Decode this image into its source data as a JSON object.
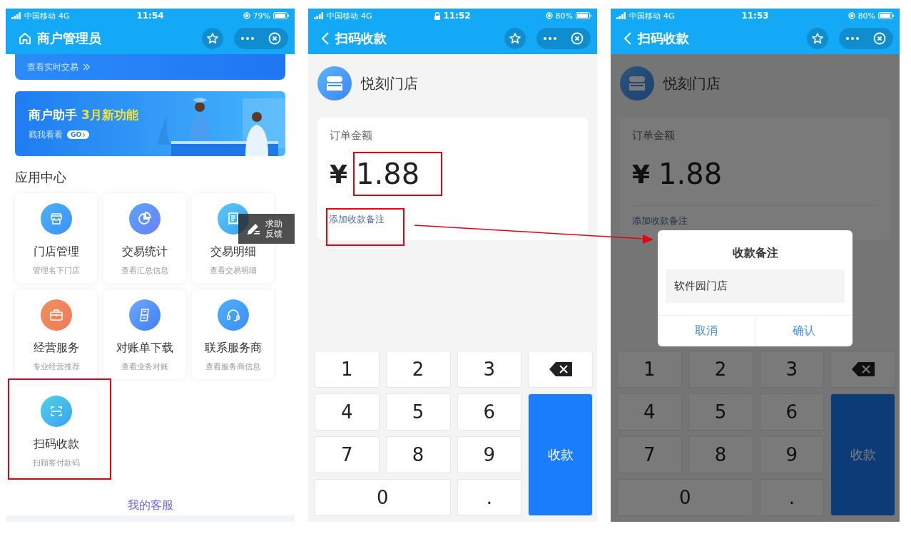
{
  "phones": [
    {
      "kind": "home",
      "status_bar": {
        "carrier": "中国移动",
        "network": "4G",
        "time": "11:54",
        "locked": false,
        "battery": "79%"
      },
      "nav": {
        "kind": "home",
        "title": "商户管理员"
      },
      "summary_card": {
        "link": "查看实时交易"
      },
      "banner": {
        "title": "商户助手",
        "highlight": "3月新功能",
        "link": "戳我看看",
        "badge": "GO"
      },
      "section_title": "应用中心",
      "apps": [
        {
          "name": "门店管理",
          "description": "管理名下门店",
          "annotated": false
        },
        {
          "name": "交易统计",
          "description": "查看汇总信息",
          "annotated": false
        },
        {
          "name": "交易明细",
          "description": "查看交易明细",
          "annotated": false
        },
        {
          "name": "经营服务",
          "description": "专业经营推荐",
          "annotated": false
        },
        {
          "name": "对账单下载",
          "description": "查看业务对账",
          "annotated": false
        },
        {
          "name": "联系服务商",
          "description": "查看服务商信息",
          "annotated": false
        },
        {
          "name": "扫码收款",
          "description": "扫顾客付款码",
          "annotated": true
        }
      ],
      "feedback": {
        "lines": [
          "求助",
          "反馈"
        ]
      },
      "footer_link": "我的客服"
    },
    {
      "kind": "payment",
      "status_bar": {
        "carrier": "中国移动",
        "network": "4G",
        "time": "11:52",
        "locked": true,
        "battery": "80%"
      },
      "nav": {
        "kind": "back",
        "title": "扫码收款"
      },
      "store": "悦刻门店",
      "amount_label": "订单金额",
      "currency": "¥",
      "amount": "1.88",
      "amount_annotated": true,
      "remark_link": "添加收款备注",
      "remark_annotated": true,
      "keys": [
        {
          "kind": "digit",
          "label": "1"
        },
        {
          "kind": "digit",
          "label": "2"
        },
        {
          "kind": "digit",
          "label": "3"
        },
        {
          "kind": "digit",
          "label": "4"
        },
        {
          "kind": "digit",
          "label": "5"
        },
        {
          "kind": "digit",
          "label": "6"
        },
        {
          "kind": "digit",
          "label": "7"
        },
        {
          "kind": "digit",
          "label": "8"
        },
        {
          "kind": "digit",
          "label": "9"
        },
        {
          "kind": "wide",
          "label": "0"
        },
        {
          "kind": "digit",
          "label": "."
        }
      ],
      "side_keys": [
        {
          "kind": "backspace"
        },
        {
          "kind": "submit",
          "label": "收款"
        }
      ]
    },
    {
      "kind": "payment",
      "status_bar": {
        "carrier": "中国移动",
        "network": "4G",
        "time": "11:53",
        "locked": false,
        "battery": "80%"
      },
      "nav": {
        "kind": "back",
        "title": "扫码收款"
      },
      "store": "悦刻门店",
      "amount_label": "订单金额",
      "currency": "¥",
      "amount": "1.88",
      "amount_annotated": false,
      "remark_link": "添加收款备注",
      "remark_annotated": false,
      "keys": [
        {
          "kind": "digit",
          "label": "1"
        },
        {
          "kind": "digit",
          "label": "2"
        },
        {
          "kind": "digit",
          "label": "3"
        },
        {
          "kind": "digit",
          "label": "4"
        },
        {
          "kind": "digit",
          "label": "5"
        },
        {
          "kind": "digit",
          "label": "6"
        },
        {
          "kind": "digit",
          "label": "7"
        },
        {
          "kind": "digit",
          "label": "8"
        },
        {
          "kind": "digit",
          "label": "9"
        },
        {
          "kind": "wide",
          "label": "0"
        },
        {
          "kind": "digit",
          "label": "."
        }
      ],
      "side_keys": [
        {
          "kind": "backspace"
        },
        {
          "kind": "submit",
          "label": "收款"
        }
      ],
      "dialog": {
        "title": "收款备注",
        "value": "软件园门店",
        "buttons": [
          "取消",
          "确认"
        ]
      }
    }
  ],
  "connector_arrow": true
}
